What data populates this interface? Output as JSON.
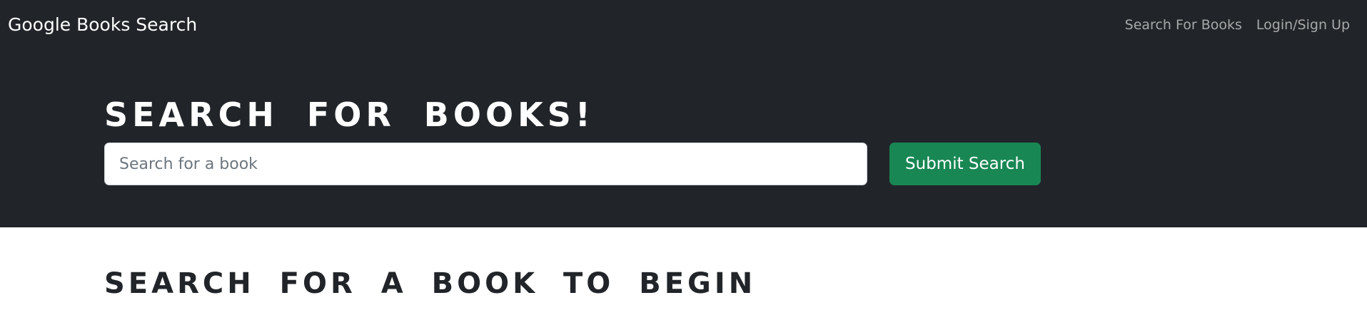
{
  "navbar": {
    "brand": "Google Books Search",
    "links": [
      {
        "label": "Search For Books"
      },
      {
        "label": "Login/Sign Up"
      }
    ]
  },
  "hero": {
    "title": "Search for Books!",
    "search": {
      "placeholder": "Search for a book",
      "value": ""
    },
    "submit_label": "Submit Search"
  },
  "results": {
    "heading": "Search for a book to begin"
  },
  "colors": {
    "navbar_bg": "#212529",
    "submit_button": "#198754",
    "heading_text": "#212529"
  }
}
